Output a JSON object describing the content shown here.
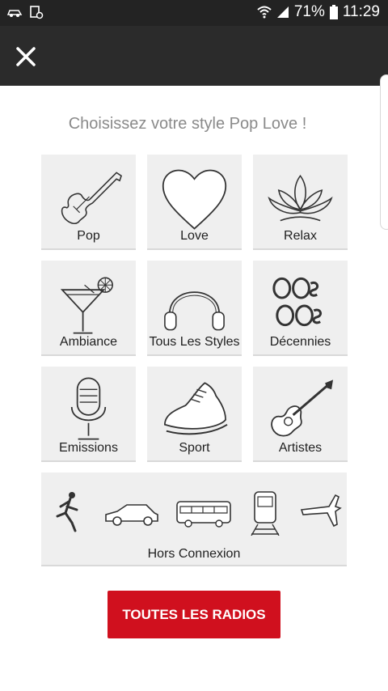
{
  "status_bar": {
    "battery": "71%",
    "time": "11:29"
  },
  "header": {
    "close_icon": "close-icon"
  },
  "page": {
    "title": "Choisissez votre style Pop Love !"
  },
  "styles": [
    {
      "label": "Pop",
      "icon": "guitar-icon"
    },
    {
      "label": "Love",
      "icon": "heart-icon"
    },
    {
      "label": "Relax",
      "icon": "lotus-icon"
    },
    {
      "label": "Ambiance",
      "icon": "cocktail-icon"
    },
    {
      "label": "Tous Les Styles",
      "icon": "headphones-icon"
    },
    {
      "label": "Décennies",
      "icon": "decades-icon"
    },
    {
      "label": "Emissions",
      "icon": "microphone-icon"
    },
    {
      "label": "Sport",
      "icon": "sneaker-icon"
    },
    {
      "label": "Artistes",
      "icon": "acoustic-guitar-icon"
    }
  ],
  "offline": {
    "label": "Hors Connexion"
  },
  "all_radios": {
    "label": "TOUTES LES RADIOS"
  },
  "colors": {
    "accent": "#d0101e",
    "appbar": "#2b2b2b",
    "tile": "#efefef"
  }
}
